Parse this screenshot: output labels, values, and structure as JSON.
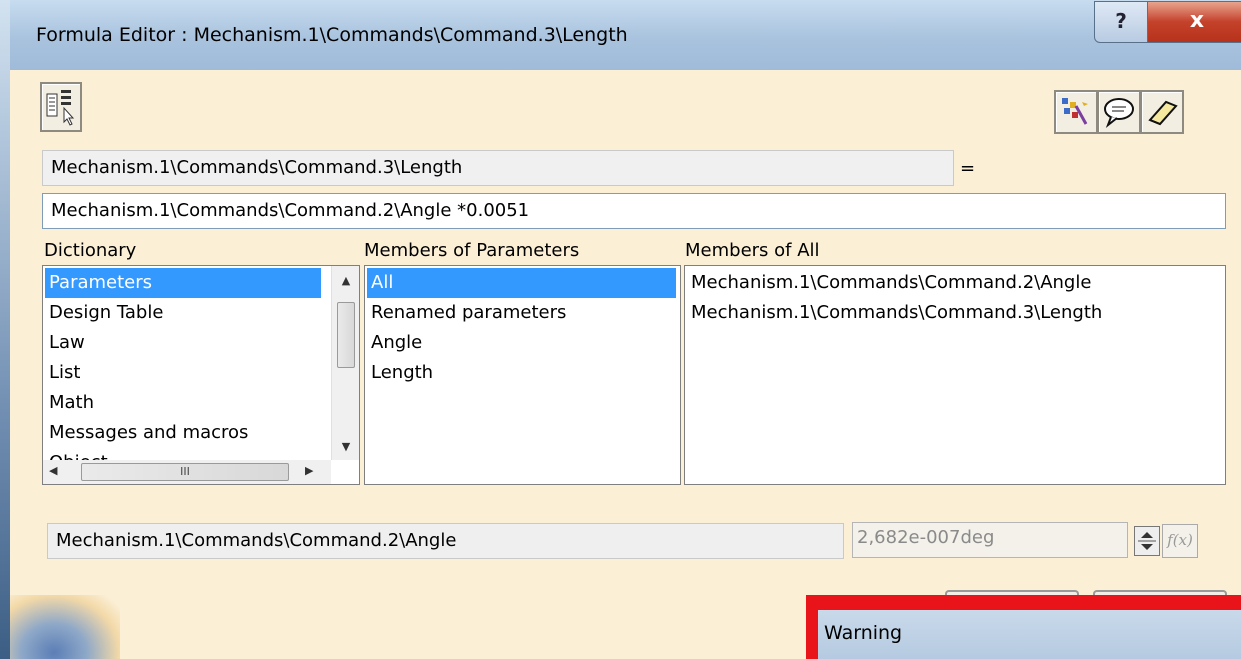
{
  "window": {
    "title": "Formula Editor : Mechanism.1\\Commands\\Command.3\\Length",
    "help_label": "?",
    "close_label": "x"
  },
  "toolbar": {
    "left_icon": "incremental-mode-icon",
    "right_icons": [
      "object-browser-icon",
      "comment-icon",
      "eraser-icon"
    ]
  },
  "formula": {
    "target_parameter": "Mechanism.1\\Commands\\Command.3\\Length",
    "equals": "=",
    "expression": "Mechanism.1\\Commands\\Command.2\\Angle *0.0051"
  },
  "dictionary": {
    "label": "Dictionary",
    "items": [
      "Parameters",
      "Design Table",
      "Law",
      "List",
      "Math",
      "Messages and macros",
      "Object"
    ],
    "selected": "Parameters",
    "hscroll_grip": "III"
  },
  "members_of_parameters": {
    "label": "Members of Parameters",
    "items": [
      "All",
      "Renamed parameters",
      "Angle",
      "Length"
    ],
    "selected": "All"
  },
  "members_of_all": {
    "label": "Members of All",
    "items": [
      "Mechanism.1\\Commands\\Command.2\\Angle",
      "Mechanism.1\\Commands\\Command.3\\Length"
    ]
  },
  "bottom": {
    "selected_member": "Mechanism.1\\Commands\\Command.2\\Angle",
    "value": "2,682e-007deg",
    "fx_label": "f(x)"
  },
  "warning": {
    "title": "Warning"
  },
  "colors": {
    "client_bg": "#fbefd5",
    "selection": "#3399ff",
    "warning_border": "#e8141a"
  }
}
